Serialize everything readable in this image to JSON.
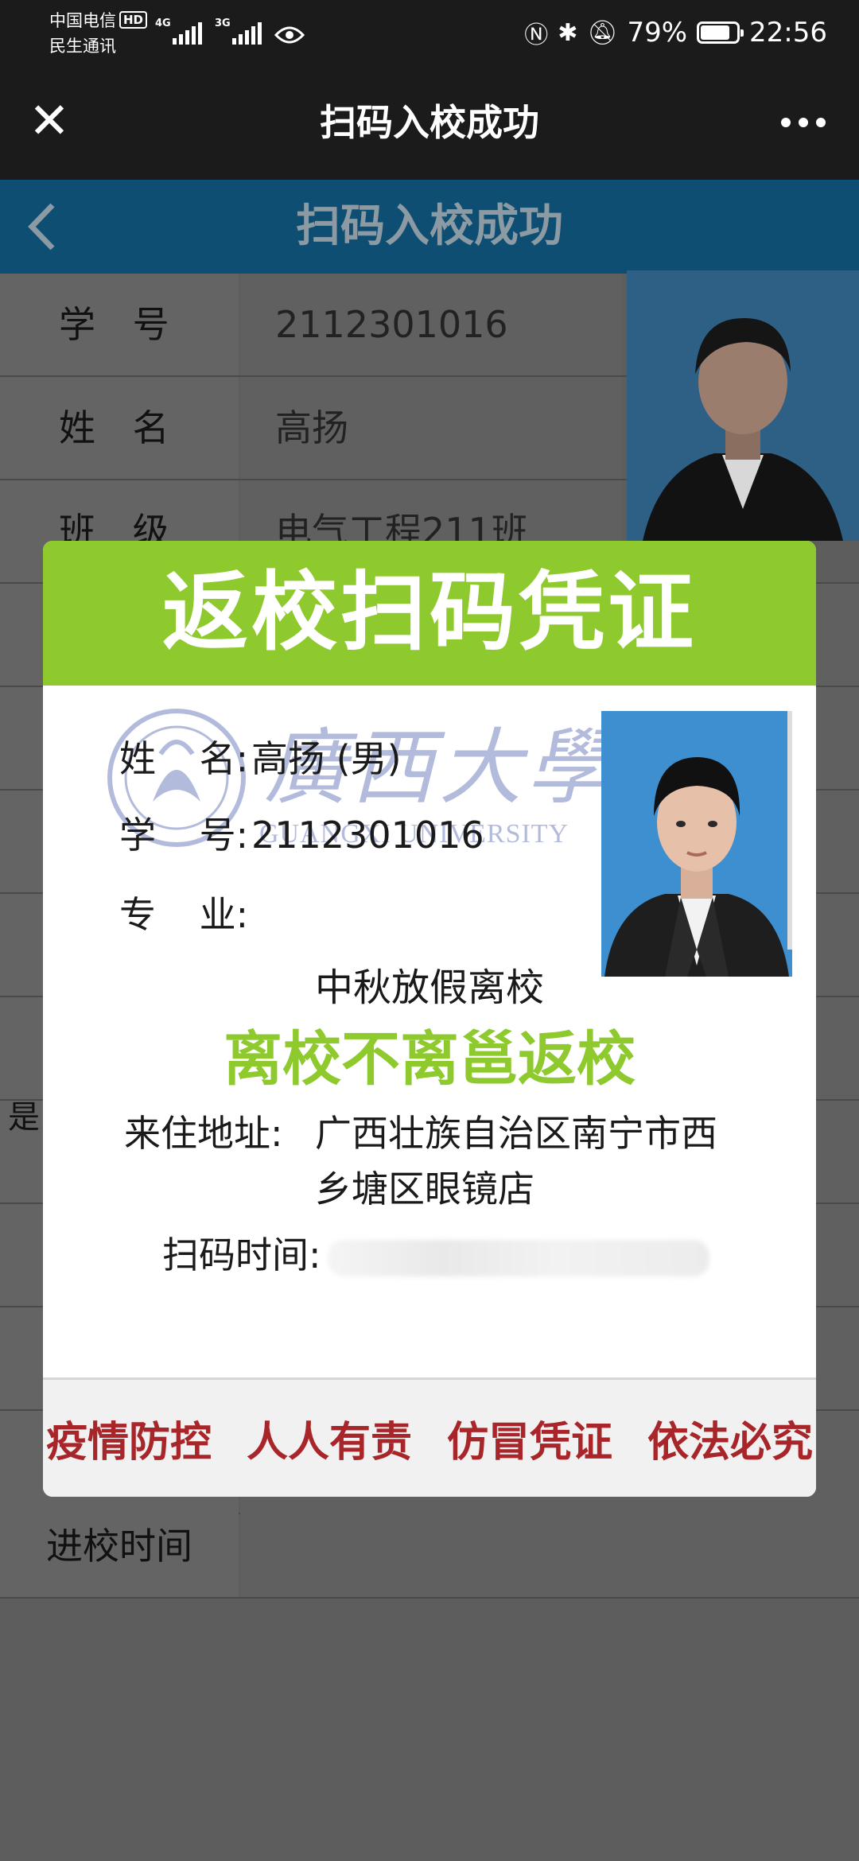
{
  "status": {
    "carrier_line1": "中国电信",
    "carrier_hd": "HD",
    "carrier_line2": "民生通讯",
    "net1": "4G",
    "net2": "3G",
    "battery": "79%",
    "time": "22:56"
  },
  "titlebar": {
    "title": "扫码入校成功"
  },
  "page": {
    "title": "扫码入校成功"
  },
  "rows": [
    {
      "label": "学 号",
      "value": "2112301016"
    },
    {
      "label": "姓 名",
      "value": "高扬"
    },
    {
      "label": "班 级",
      "value": "电气工程211班"
    }
  ],
  "side_partial": "是",
  "entry_row": {
    "label": "进校时间"
  },
  "card": {
    "header": "返校扫码凭证",
    "name_label": "姓 名:",
    "name_value": "高扬 (男)",
    "id_label": "学 号:",
    "id_value": "2112301016",
    "major_label": "专 业:",
    "major_value": "",
    "subtitle": "中秋放假离校",
    "slogan": "离校不离邕返校",
    "address_label": "来住地址:",
    "address_line1": "广西壮族自治区南宁市西",
    "address_line2": "乡塘区眼镜店",
    "scan_time_label": "扫码时间:",
    "watermark_cn": "廣西大學",
    "watermark_en": "GUANGXI UNIVERSITY",
    "footer": [
      "疫情防控",
      "人人有责",
      "仿冒凭证",
      "依法必究"
    ]
  },
  "colors": {
    "card_header": "#8ec92d",
    "slogan": "#8ec92d",
    "footer_text": "#a8262a",
    "page_header": "#0f4e73",
    "photo_bg": "#3d8fd0"
  }
}
